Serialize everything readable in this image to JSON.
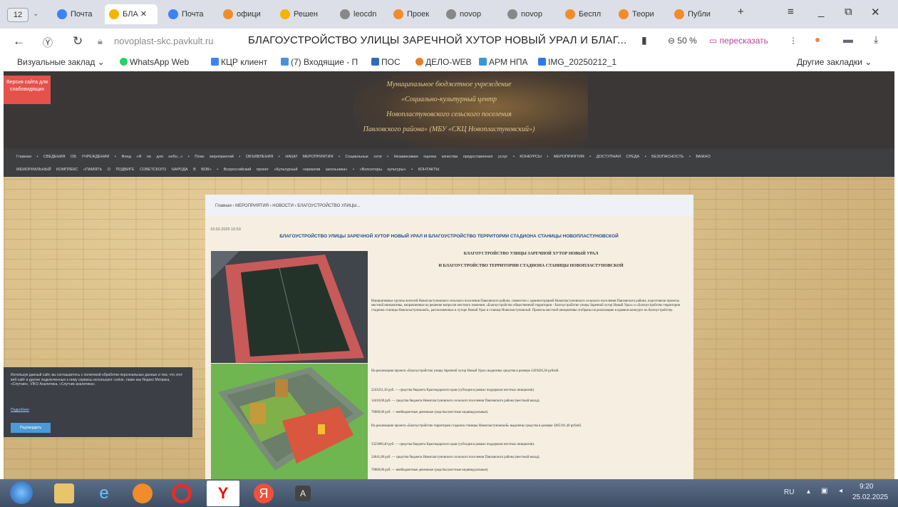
{
  "browser": {
    "tab_count": "12",
    "tabs": [
      {
        "label": "Почта",
        "color": "#3b82f6"
      },
      {
        "label": "БЛА",
        "color": "#f4b400",
        "active": true
      },
      {
        "label": "Почта",
        "color": "#3b82f6"
      },
      {
        "label": "офици",
        "color": "#f28c28"
      },
      {
        "label": "Решен",
        "color": "#f4b400"
      },
      {
        "label": "leocdn",
        "color": "#888888"
      },
      {
        "label": "Проек",
        "color": "#f28c28"
      },
      {
        "label": "novop",
        "color": "#888888"
      },
      {
        "label": "novop",
        "color": "#888888"
      },
      {
        "label": "Беспл",
        "color": "#f28c28"
      },
      {
        "label": "Теори",
        "color": "#f28c28"
      },
      {
        "label": "Публи",
        "color": "#f28c28"
      }
    ],
    "url": "novoplast-skc.pavkult.ru",
    "page_title": "БЛАГОУСТРОЙСТВО УЛИЦЫ ЗАРЕЧНОЙ ХУТОР НОВЫЙ УРАЛ И БЛАГ...",
    "zoom": "50 %",
    "retell_label": "пересказать",
    "bookmarks": [
      "Визуальные заклад",
      "WhatsApp Web",
      "КЦР клиент",
      "(7) Входящие - П",
      "ПОС",
      "ДЕЛО-WEB",
      "АРМ НПА",
      "IMG_20250212_1"
    ],
    "other_bookmarks": "Другие закладки"
  },
  "site": {
    "access_button": "Версия сайта для слабовидящих",
    "header_lines": [
      "Муниципальное бюджетное учреждение",
      "«Социально-культурный центр",
      "Новопластуновского сельского поселения",
      "Павловского района» (МБУ «СКЦ Новопластуновский»)"
    ],
    "menu_row1": "Главная • СВЕДЕНИЯ ОБ УЧРЕЖДЕНИИ • Фонд «Я не для небо...» • План мероприятий • ОБЪЯВЛЕНИЯ • НАШИ МЕРОПРИЯТИЯ • Социальные сети • Независимая оценка качества предоставления услуг • КОНКУРСЫ • МЕРОПРИЯТИЯ • ДОСТУПНАЯ СРЕДА • БЕЗОПАСНОСТЬ • ВАЖНО",
    "menu_row2": "МЕМОРИАЛЬНЫЙ КОМПЛЕКС «ПАМЯТЬ О ПОДВИГЕ СОВЕТСКОГО НАРОДА В ВОВ» • Всероссийский проект «Культурный норматив школьника» • «Волонтеры культуры» • КОНТАКТЫ",
    "breadcrumb": "Главная › МЕРОПРИЯТИЯ › НОВОСТИ › БЛАГОУСТРОЙСТВО УЛИЦЫ...",
    "date": "19.02.2025 10:53",
    "article_title": "БЛАГОУСТРОЙСТВО УЛИЦЫ ЗАРЕЧНОЙ ХУТОР НОВЫЙ УРАЛ И БЛАГОУСТРОЙСТВО ТЕРРИТОРИИ СТАДИОНА СТАНИЦЫ НОВОПЛАСТУНОВСКОЙ",
    "subtitle1": "БЛАГОУСТРОЙСТВО УЛИЦЫ ЗАРЕЧНОЙ ХУТОР НОВЫЙ УРАЛ",
    "subtitle2": "И БЛАГОУСТРОЙСТВО ТЕРРИТОРИИ СТАДИОНА СТАНИЦЫ НОВОПЛАСТУНОВСКОЙ",
    "paragraphs": [
      "Инициативные группы жителей Новопластуновского сельского поселения Павловского района, совместно с администрацией Новопластуновского сельского поселения Павловского района, подготовили проекты местной инициативы, направленные на решение вопросов местного значения: «Благоустройство общественной территории - Благоустройство улицы Заречной хутор Новый Урал» и «Благоустройство территории стадиона станицы Новопластуновской», расположенных в хуторе Новый Урал и станице Новопластуновской. Проекты местной инициативы отобраны на реализацию в краевом конкурсе по благоустройству.",
      "На реализацию проекта «Благоустройство улицы Заречной хутор Новый Урал» выделены средства в размере 2439426,36 рублей.",
      "2243231,36 руб. — средства бюджета Краснодарского края (субсидия в рамках поддержки местных инициатив).",
      "14418,00 руб. — средства бюджета Новопластуновского сельского поселения Павловского района (местный вклад).",
      "70000,00 руб. — внебюджетные денежные средства (местные индивидуальные).",
      "На реализацию проекта «Благоустройство территории стадиона станицы Новопластуновской» выделены средства в размере 3465181,40 рублей.",
      "3323060,40 руб. — средства бюджета Краснодарского края (субсидия в рамках поддержки местных инициатив).",
      "24641,00 руб. — средства бюджета Новопластуновского сельского поселения Павловского района (местный вклад).",
      "70000,00 руб. — внебюджетные денежные средства (местные индивидуальные)."
    ],
    "cookie_text": "Используя данный сайт, вы соглашаетесь с политикой обработки персональных данных и тем, что этот веб-сайт и другие подключенные к нему сервисы используют cookie, такие как Яндекс Метрика, «Спутник», VIKO Аналитика, «Спутник аналитика».",
    "cookie_more": "Подробнее",
    "cookie_button": "Подтвердить"
  },
  "taskbar": {
    "lang": "RU",
    "time": "9:20",
    "date": "25.02.2025"
  }
}
